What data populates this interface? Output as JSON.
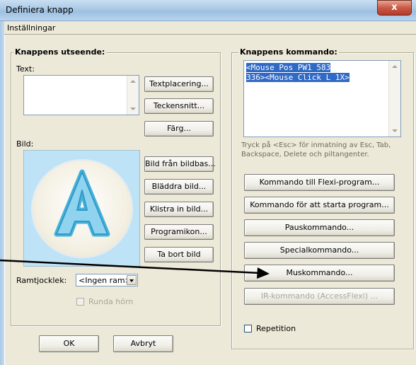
{
  "window": {
    "title": "Definiera knapp",
    "close_glyph": "x"
  },
  "menu": {
    "tab_label": "Inställningar"
  },
  "appearance": {
    "legend": "Knappens utseende:",
    "text_label": "Text:",
    "text_value": "",
    "image_label": "Bild:",
    "image_letter": "A",
    "buttons": {
      "text_placement": "Textplacering...",
      "font": "Teckensnitt...",
      "color": "Färg...",
      "from_image_bank": "Bild från bildbas...",
      "browse_image": "Bläddra bild...",
      "paste_image": "Klistra in bild...",
      "program_icon": "Programikon...",
      "remove_image": "Ta bort bild"
    },
    "frame_label": "Ramtjocklek:",
    "frame_value": "<Ingen ram>",
    "round_corners_label": "Runda hörn"
  },
  "command": {
    "legend": "Knappens kommando:",
    "text_line1": "<Mouse Pos PW1 583",
    "text_line2": "336><Mouse Click L 1X>",
    "hint": "Tryck på <Esc> för inmatning av Esc, Tab, Backspace, Delete och piltangenter.",
    "buttons": {
      "flexi_program": "Kommando till Flexi-program...",
      "start_program": "Kommando för att starta program...",
      "pause": "Pauskommando...",
      "special": "Specialkommando...",
      "mouse": "Muskommando...",
      "ir": "IR-kommando (AccessFlexi) ..."
    },
    "repeat_label": "Repetition"
  },
  "footer": {
    "ok_label": "OK",
    "cancel_label": "Avbryt"
  },
  "colors": {
    "selection": "#316ac5",
    "title_gradient": "#a9c8e6",
    "image_bg": "#bfe3f6",
    "letter": "#47b3dd"
  }
}
